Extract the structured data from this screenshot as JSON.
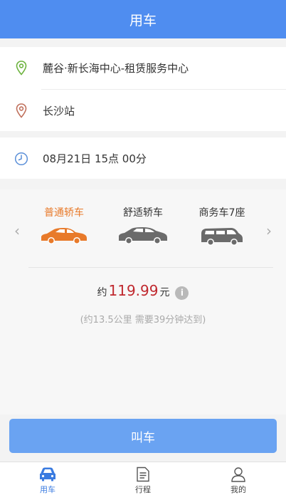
{
  "header": {
    "title": "用车"
  },
  "route": {
    "pickup": "麓谷·新长海中心-租赁服务中心",
    "dropoff": "长沙站"
  },
  "schedule": {
    "time": "08月21日 15点 00分"
  },
  "car_types": {
    "prev": "‹",
    "next": "›",
    "items": [
      {
        "label": "普通轿车",
        "selected": true
      },
      {
        "label": "舒适轿车",
        "selected": false
      },
      {
        "label": "商务车7座",
        "selected": false
      }
    ]
  },
  "fare": {
    "prefix": "约",
    "amount": "119.99",
    "unit": "元",
    "info": "i",
    "estimate": "(约13.5公里 需要39分钟达到)"
  },
  "actions": {
    "call_label": "叫车"
  },
  "tabs": [
    {
      "label": "用车",
      "icon": "car-icon",
      "active": true
    },
    {
      "label": "行程",
      "icon": "document-icon",
      "active": false
    },
    {
      "label": "我的",
      "icon": "user-icon",
      "active": false
    }
  ],
  "colors": {
    "primary": "#4f8df0",
    "button": "#6aa3f2",
    "selected": "#e87a2a",
    "price": "#c0292f",
    "pickup_pin": "#6cb33e",
    "dropoff_pin": "#c0705c"
  }
}
